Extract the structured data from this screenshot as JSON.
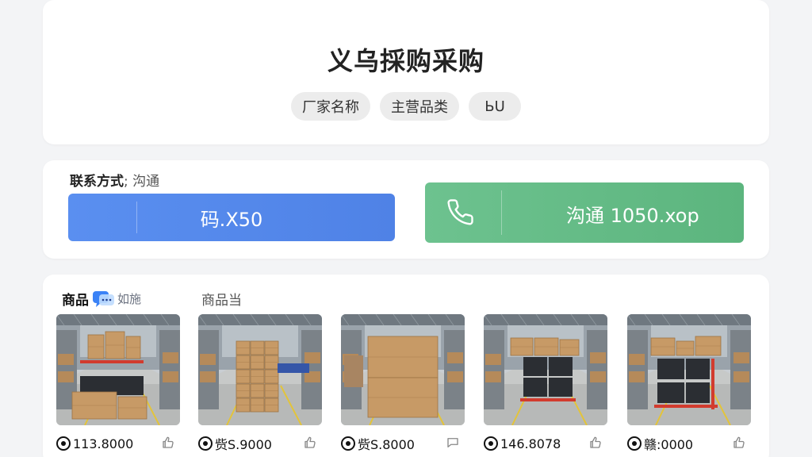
{
  "header": {
    "title": "义乌採购采购",
    "chips": [
      "厂家名称",
      "主营品类",
      "ЬU"
    ]
  },
  "contact": {
    "label_key": "联系方式",
    "label_value": "沟通",
    "wechat_label": "码.X50",
    "phone_label": "沟通 1050.xop",
    "colors": {
      "wechat": "#5a8ff0",
      "phone": "#6dc28f"
    }
  },
  "products": {
    "tab_primary": "商品",
    "tab_primary_badge": "如施",
    "tab_secondary": "商品当",
    "items": [
      {
        "price": "113.8000",
        "variant": "warehouse-red-shelf"
      },
      {
        "price": "赀S.9000",
        "variant": "warehouse-stack"
      },
      {
        "price": "赀S.8000",
        "variant": "warehouse-big-box"
      },
      {
        "price": "146.8078",
        "variant": "warehouse-black-bins"
      },
      {
        "price": "赣:0000",
        "variant": "warehouse-red-cart"
      }
    ]
  }
}
